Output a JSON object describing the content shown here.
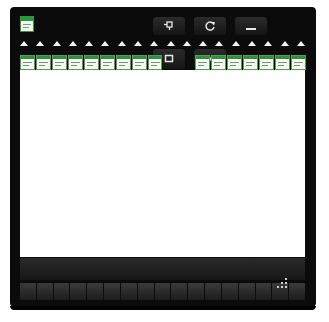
{
  "window": {
    "app_icon": "document-icon",
    "title_controls": [
      {
        "name": "pin-button",
        "icon": "pin-icon"
      },
      {
        "name": "refresh-button",
        "icon": "refresh-icon"
      },
      {
        "name": "minimize-button",
        "icon": "minimize-icon"
      },
      {
        "name": "maximize-button",
        "icon": "maximize-icon"
      },
      {
        "name": "close-button",
        "icon": "close-icon"
      }
    ]
  },
  "toolbar": {
    "arrow_count": 18,
    "document_count": 18
  },
  "colors": {
    "chrome": "#0b0b0b",
    "accent": "#2f8f3f",
    "content": "#ffffff"
  }
}
